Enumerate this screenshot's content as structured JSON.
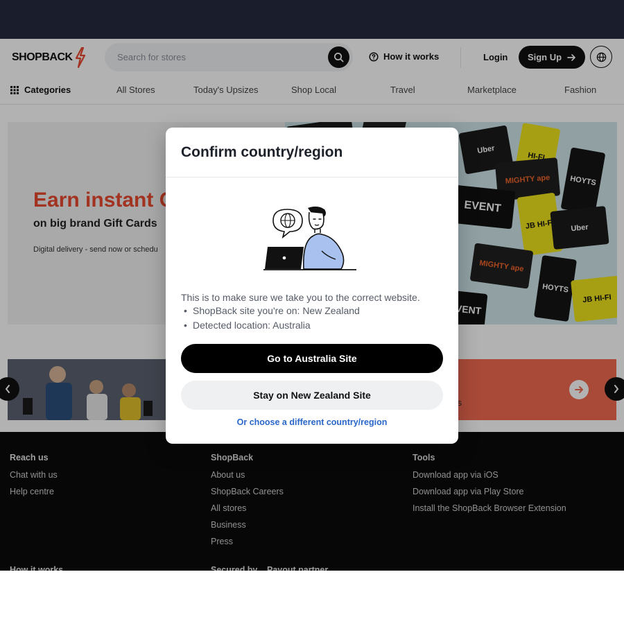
{
  "header": {
    "logo_text": "SHOPBACK",
    "search_placeholder": "Search for stores",
    "how_it_works": "How it works",
    "login": "Login",
    "signup": "Sign Up"
  },
  "nav": {
    "categories": "Categories",
    "items": [
      "All Stores",
      "Today's Upsizes",
      "Shop Local",
      "Travel",
      "Marketplace",
      "Fashion"
    ]
  },
  "banner": {
    "title": "Earn instant C",
    "subtitle": "on big brand Gift Cards",
    "note": "Digital delivery - send now or schedu",
    "gift_cards": [
      "Uber",
      "HI-FI",
      "MIGHTY ape",
      "HOYTS",
      "EVENT",
      "JB HI-FI",
      "Uber",
      "MIGHTY ape",
      "HOYTS",
      "JB HI-FI",
      "EVENT"
    ]
  },
  "promo": {
    "right_text": "rds"
  },
  "modal": {
    "title": "Confirm country/region",
    "intro": "This is to make sure we take you to the correct website.",
    "site_line": "ShopBack site you're on: New Zealand",
    "location_line": "Detected location: Australia",
    "primary_button": "Go to Australia Site",
    "secondary_button": "Stay on New Zealand Site",
    "other_link": "Or choose a different country/region"
  },
  "footer": {
    "reach_us": {
      "heading": "Reach us",
      "links": [
        "Chat with us",
        "Help centre"
      ]
    },
    "shopback": {
      "heading": "ShopBack",
      "links": [
        "About us",
        "ShopBack Careers",
        "All stores",
        "Business",
        "Press"
      ]
    },
    "tools": {
      "heading": "Tools",
      "links": [
        "Download app via iOS",
        "Download app via Play Store",
        "Install the ShopBack Browser Extension"
      ]
    },
    "sub_headings": [
      "How it works",
      "Secured by",
      "Payout partner"
    ]
  },
  "colors": {
    "brand_red": "#e8492f",
    "top_strip": "#1a1d2b",
    "link_blue": "#2a66c9"
  }
}
